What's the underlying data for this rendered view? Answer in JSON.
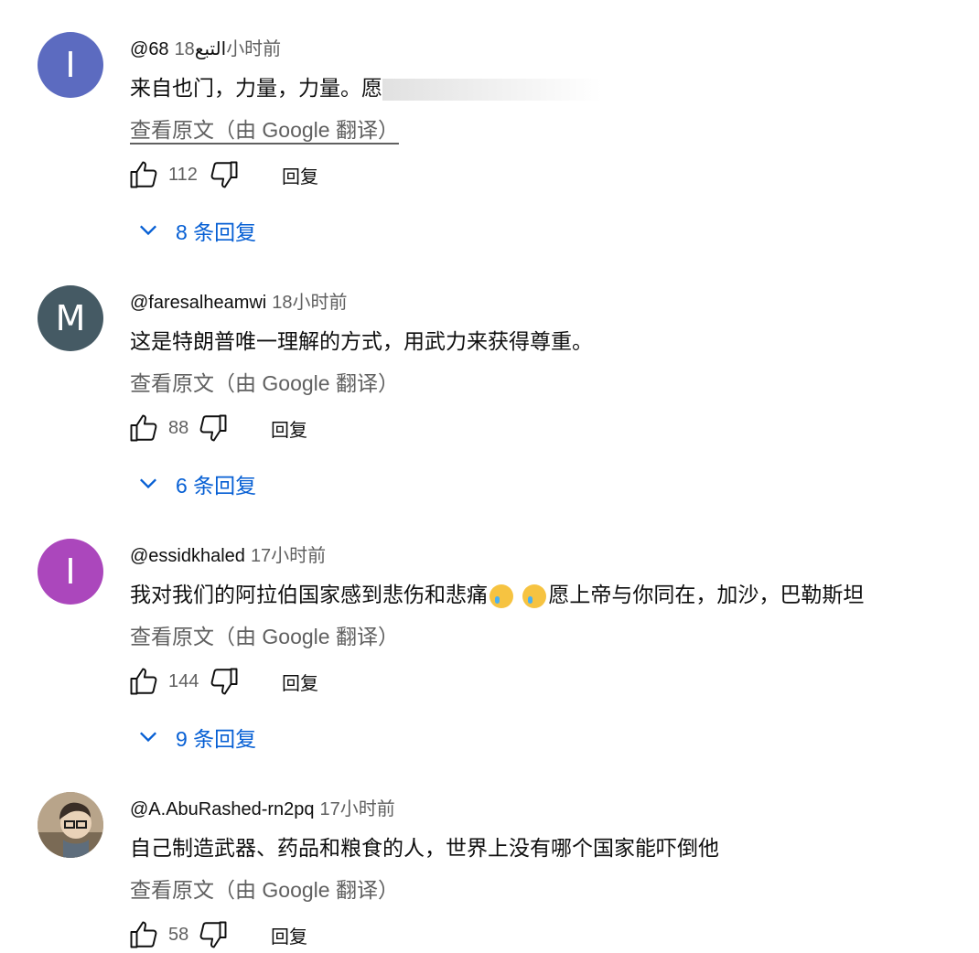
{
  "translate_label": "查看原文（由 Google 翻译）",
  "reply_label": "回复",
  "colors": {
    "link_blue": "#065fd4",
    "meta_gray": "#606060"
  },
  "comments": [
    {
      "avatar_letter": "I",
      "avatar_color": "#5c6bc0",
      "author": "@التبع68",
      "time": "18小时前",
      "text": "来自也门，力量，力量。愿",
      "likes": "112",
      "replies": "8 条回复"
    },
    {
      "avatar_letter": "M",
      "avatar_color": "#455a64",
      "author": "@faresalheamwi",
      "time": "18小时前",
      "text": "这是特朗普唯一理解的方式，用武力来获得尊重。",
      "likes": "88",
      "replies": "6 条回复"
    },
    {
      "avatar_letter": "I",
      "avatar_color": "#ab47bc",
      "author": "@essidkhaled",
      "time": "17小时前",
      "text_before": "我对我们的阿拉伯国家感到悲伤和悲痛",
      "text_after": "愿上帝与你同在，加沙，巴勒斯坦",
      "likes": "144",
      "replies": "9 条回复"
    },
    {
      "avatar_icon": "user-photo",
      "author": "@A.AbuRashed-rn2pq",
      "time": "17小时前",
      "text": "自己制造武器、药品和粮食的人，世界上没有哪个国家能吓倒他",
      "likes": "58"
    }
  ]
}
